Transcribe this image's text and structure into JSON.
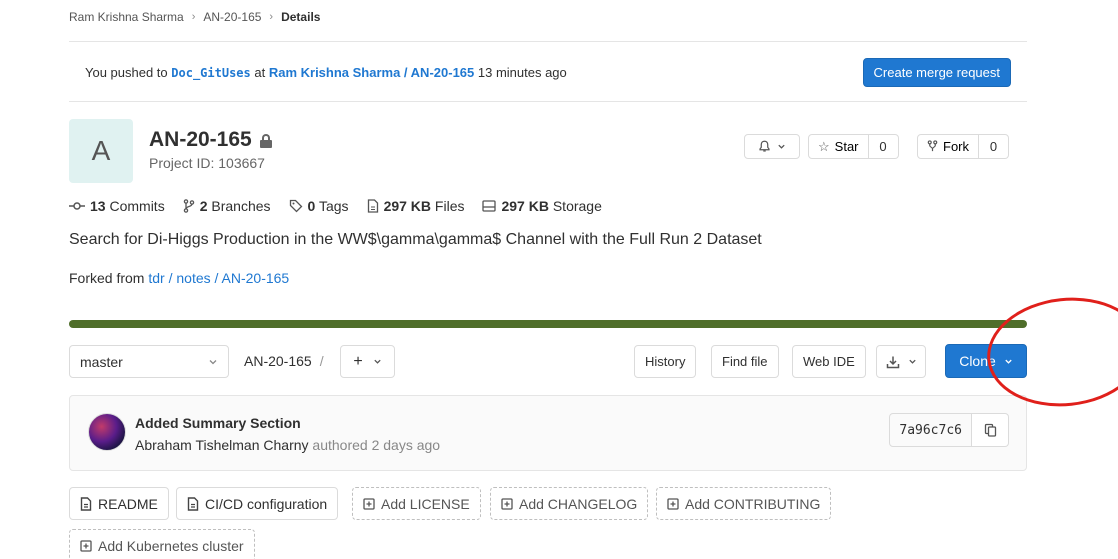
{
  "breadcrumb": {
    "items": [
      "Ram Krishna Sharma",
      "AN-20-165"
    ],
    "current": "Details"
  },
  "push_banner": {
    "prefix": "You pushed to ",
    "branch": "Doc_GitUses",
    "at": " at ",
    "project_path": "Ram Krishna Sharma / AN-20-165",
    "time": " 13 minutes ago",
    "create_mr_label": "Create merge request"
  },
  "project": {
    "avatar_letter": "A",
    "name": "AN-20-165",
    "id_label": "Project ID: 103667",
    "star_label": "Star",
    "star_count": "0",
    "fork_label": "Fork",
    "fork_count": "0"
  },
  "stats": {
    "commits_count": "13",
    "commits_label": " Commits",
    "branches_count": "2",
    "branches_label": " Branches",
    "tags_count": "0",
    "tags_label": " Tags",
    "files_size": "297 KB",
    "files_label": " Files",
    "storage_size": "297 KB",
    "storage_label": " Storage"
  },
  "description": "Search for Di-Higgs Production in the WW$\\gamma\\gamma$ Channel with the Full Run 2 Dataset",
  "forked": {
    "prefix": "Forked from ",
    "link": "tdr / notes / AN-20-165"
  },
  "pipeline": {
    "status_color": "#4f6e2a"
  },
  "tree": {
    "branch": "master",
    "path": "AN-20-165",
    "path_sep": "/",
    "add_icon": "+",
    "history_label": "History",
    "find_file_label": "Find file",
    "web_ide_label": "Web IDE",
    "clone_label": "Clone"
  },
  "commit": {
    "title": "Added Summary Section",
    "author": "Abraham Tishelman Charny",
    "authored_text": " authored 2 days ago",
    "sha": "7a96c7c6"
  },
  "shortcuts": {
    "readme": "README",
    "cicd": "CI/CD configuration",
    "add_license": "Add LICENSE",
    "add_changelog": "Add CHANGELOG",
    "add_contributing": "Add CONTRIBUTING",
    "add_kubernetes": "Add Kubernetes cluster"
  },
  "colors": {
    "accent": "#1f78d1",
    "annotation": "#e0201b"
  }
}
